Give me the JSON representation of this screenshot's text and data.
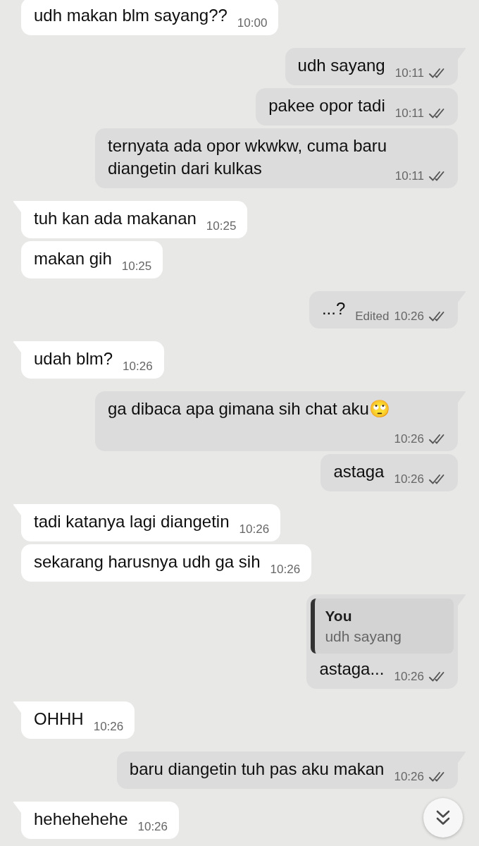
{
  "messages": [
    {
      "kind": "received",
      "tail": false,
      "text": "udh makan blm sayang??",
      "time": "10:00"
    },
    {
      "kind": "sent",
      "tail": true,
      "text": "udh sayang",
      "time": "10:11",
      "read": false
    },
    {
      "kind": "sent",
      "tail": false,
      "text": "pakee opor tadi",
      "time": "10:11",
      "read": false
    },
    {
      "kind": "sent",
      "tail": false,
      "text": "ternyata ada opor wkwkw, cuma baru diangetin dari kulkas",
      "time": "10:11",
      "read": false
    },
    {
      "kind": "received",
      "tail": true,
      "text": "tuh kan ada makanan",
      "time": "10:25"
    },
    {
      "kind": "received",
      "tail": false,
      "text": "makan gih",
      "time": "10:25"
    },
    {
      "kind": "sent",
      "tail": true,
      "text": "...?",
      "edited_label": "Edited",
      "time": "10:26",
      "read": false
    },
    {
      "kind": "received",
      "tail": true,
      "text": "udah blm?",
      "time": "10:26"
    },
    {
      "kind": "sent",
      "tail": true,
      "text": "ga dibaca apa gimana sih chat aku🙄",
      "time": "10:26",
      "read": false
    },
    {
      "kind": "sent",
      "tail": false,
      "text": "astaga",
      "time": "10:26",
      "read": false
    },
    {
      "kind": "received",
      "tail": true,
      "text": "tadi katanya lagi diangetin",
      "time": "10:26"
    },
    {
      "kind": "received",
      "tail": false,
      "text": "sekarang harusnya udh ga sih",
      "time": "10:26"
    },
    {
      "kind": "sent",
      "tail": true,
      "quote": {
        "author": "You",
        "text": "udh sayang"
      },
      "text": "astaga...",
      "time": "10:26",
      "read": false
    },
    {
      "kind": "received",
      "tail": true,
      "text": "OHHH",
      "time": "10:26"
    },
    {
      "kind": "sent",
      "tail": true,
      "text": "baru diangetin tuh pas aku makan",
      "time": "10:26",
      "read": false
    },
    {
      "kind": "received",
      "tail": true,
      "text": "hehehehehe",
      "time": "10:26"
    }
  ]
}
